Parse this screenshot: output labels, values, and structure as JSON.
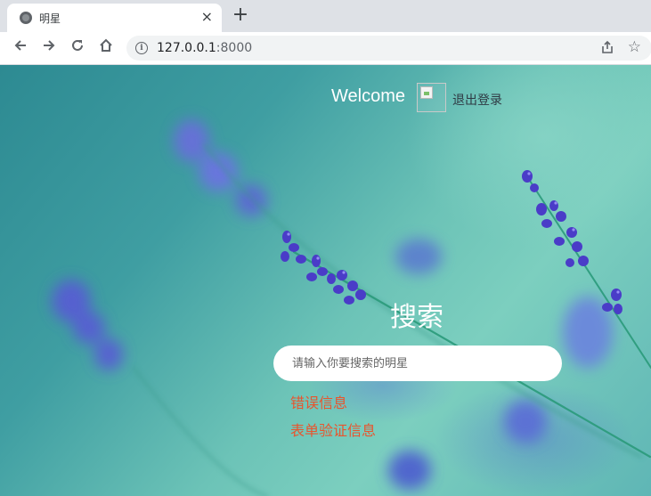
{
  "browser": {
    "tab_title": "明星",
    "close_glyph": "×",
    "new_tab_glyph": "+",
    "url_host": "127.0.0.1",
    "url_port": ":8000",
    "icons": {
      "favicon": "globe-icon",
      "back": "back-arrow-icon",
      "forward": "forward-arrow-icon",
      "reload": "reload-icon",
      "home": "home-icon",
      "info": "info-icon",
      "share": "share-icon",
      "bookmark": "star-icon"
    }
  },
  "header": {
    "welcome": "Welcome",
    "logout": "退出登录"
  },
  "search": {
    "title": "搜索",
    "placeholder": "请输入你要搜索的明星"
  },
  "messages": {
    "error_info": "错误信息",
    "form_validation": "表单验证信息"
  },
  "colors": {
    "error_text": "#e8552e",
    "background_teal": "#3f9ea2",
    "flower_purple": "#4a3cc8"
  }
}
